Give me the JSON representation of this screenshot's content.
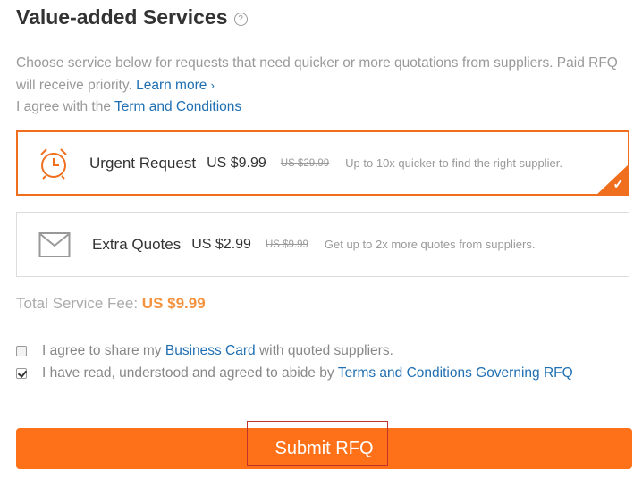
{
  "header": {
    "title": "Value-added Services",
    "help_icon": "question-circle-icon"
  },
  "description": {
    "line1": "Choose service below for requests that need quicker or more quotations from suppliers. Paid RFQ will receive priority.",
    "learn_more": "Learn more",
    "line2_prefix": "I agree with the",
    "terms_link": "Term and Conditions"
  },
  "services": [
    {
      "icon": "alarm-clock-icon",
      "name": "Urgent Request",
      "price": "US $9.99",
      "old_price": "US $29.99",
      "note": "Up to 10x quicker to find the right supplier.",
      "selected": true
    },
    {
      "icon": "envelope-icon",
      "name": "Extra Quotes",
      "price": "US $2.99",
      "old_price": "US $9.99",
      "note": "Get up to 2x more quotes from suppliers.",
      "selected": false
    }
  ],
  "total": {
    "label": "Total Service Fee:",
    "amount": "US $9.99"
  },
  "agreements": [
    {
      "checked": false,
      "prefix": "I agree to share my",
      "link": "Business Card",
      "suffix": "with quoted suppliers."
    },
    {
      "checked": true,
      "prefix": "I have read, understood and agreed to abide by",
      "link": "Terms and Conditions Governing RFQ",
      "suffix": ""
    }
  ],
  "submit": {
    "label": "Submit RFQ"
  },
  "colors": {
    "accent": "#ff7119",
    "selected_border": "#f06f1e",
    "link": "#1f6fb2",
    "fee_amount": "#f5923e"
  }
}
